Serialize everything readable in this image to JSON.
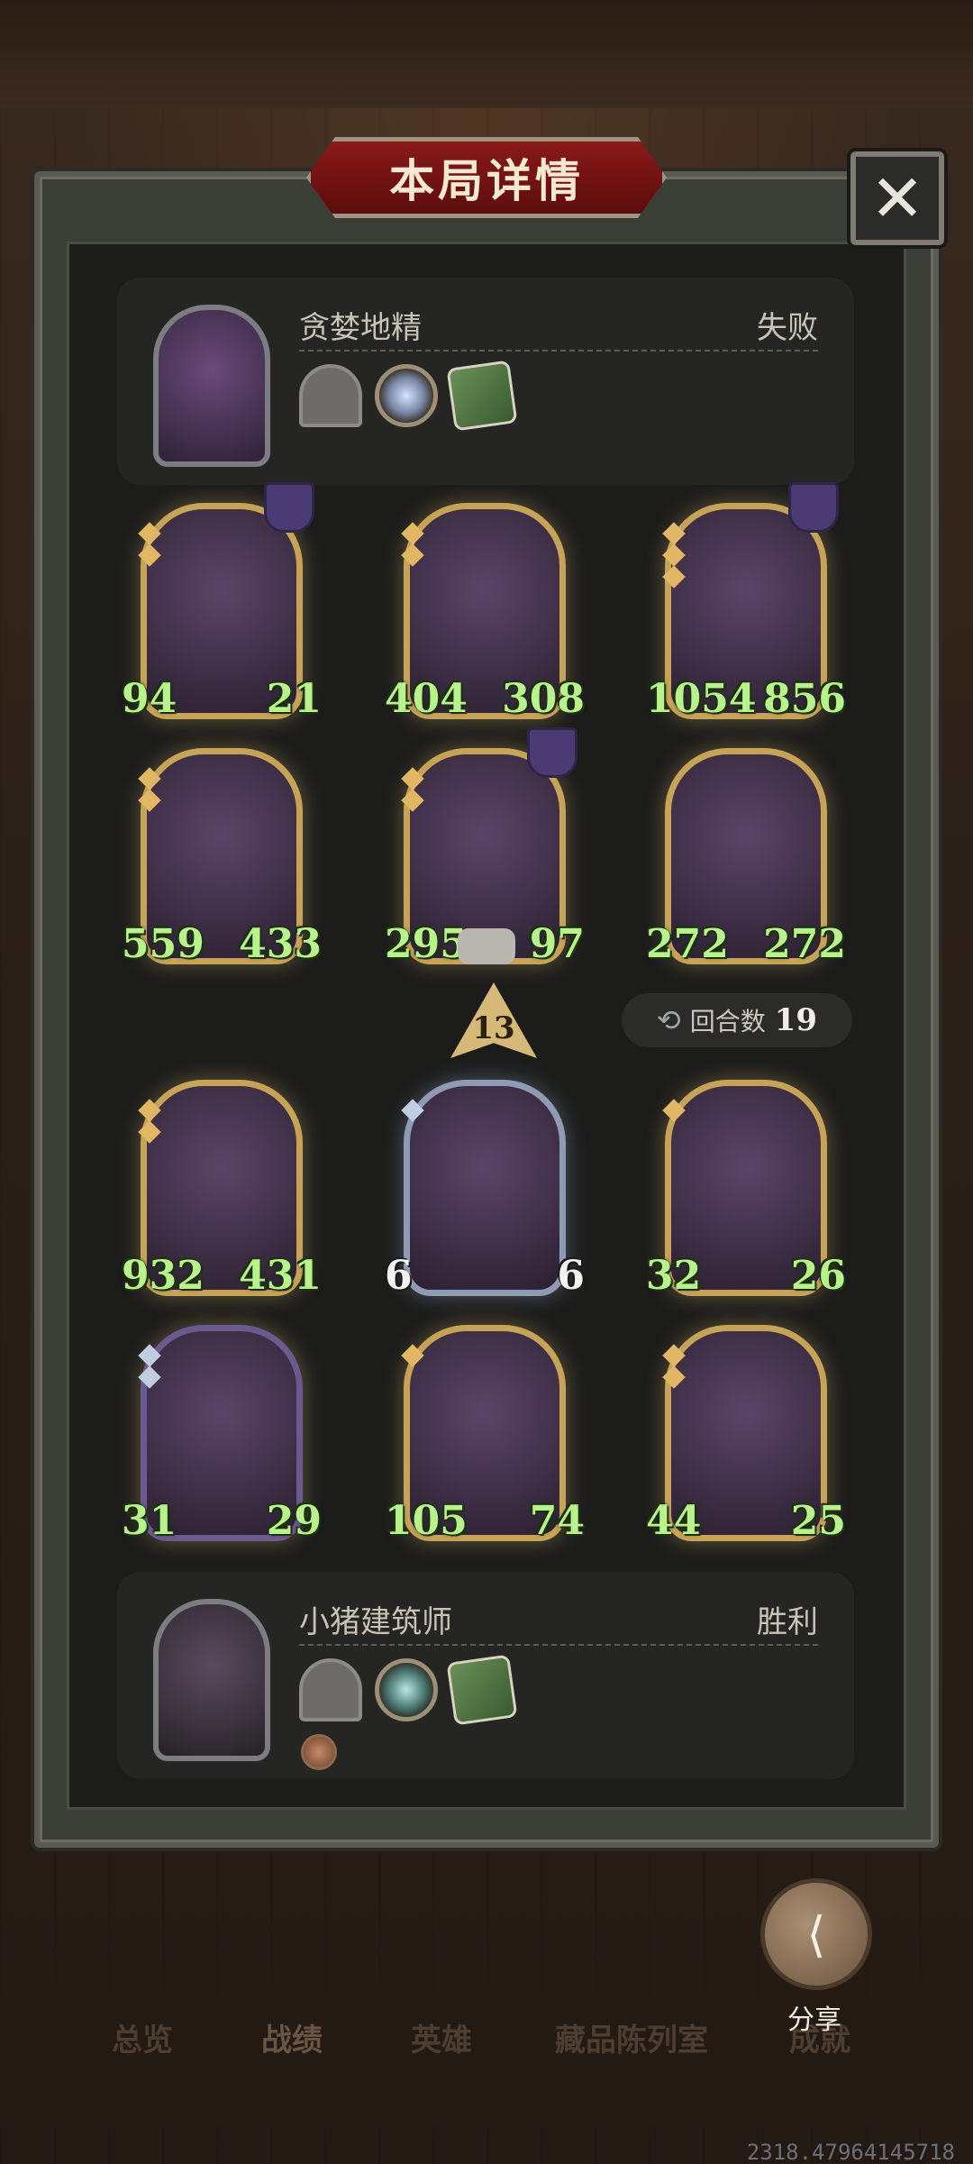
{
  "header": {
    "title": "本局详情",
    "close_icon": "close-icon"
  },
  "player_top": {
    "name": "贪婪地精",
    "result": "失败",
    "items": [
      "portal-icon",
      "orb-icon",
      "book-icon"
    ]
  },
  "player_bottom": {
    "name": "小猪建筑师",
    "result": "胜利",
    "items": [
      "portal-icon",
      "orb-icon",
      "book-icon",
      "coin-icon"
    ]
  },
  "board_top": [
    {
      "atk": "94",
      "hp": "21"
    },
    {
      "atk": "404",
      "hp": "308"
    },
    {
      "atk": "1054",
      "hp": "856"
    },
    {
      "atk": "559",
      "hp": "433"
    },
    {
      "atk": "295",
      "hp": "97"
    },
    {
      "atk": "272",
      "hp": "272"
    }
  ],
  "board_bottom": [
    {
      "atk": "932",
      "hp": "431"
    },
    {
      "atk": "6",
      "hp": "6"
    },
    {
      "atk": "32",
      "hp": "26"
    },
    {
      "atk": "31",
      "hp": "29"
    },
    {
      "atk": "105",
      "hp": "74"
    },
    {
      "atk": "44",
      "hp": "25"
    }
  ],
  "tier": "13",
  "turns": {
    "label": "回合数",
    "value": "19"
  },
  "share": {
    "label": "分享"
  },
  "tabs": [
    "总览",
    "战绩",
    "英雄",
    "藏品陈列室",
    "成就"
  ],
  "footer": {
    "coords": "2318.47964145718"
  }
}
